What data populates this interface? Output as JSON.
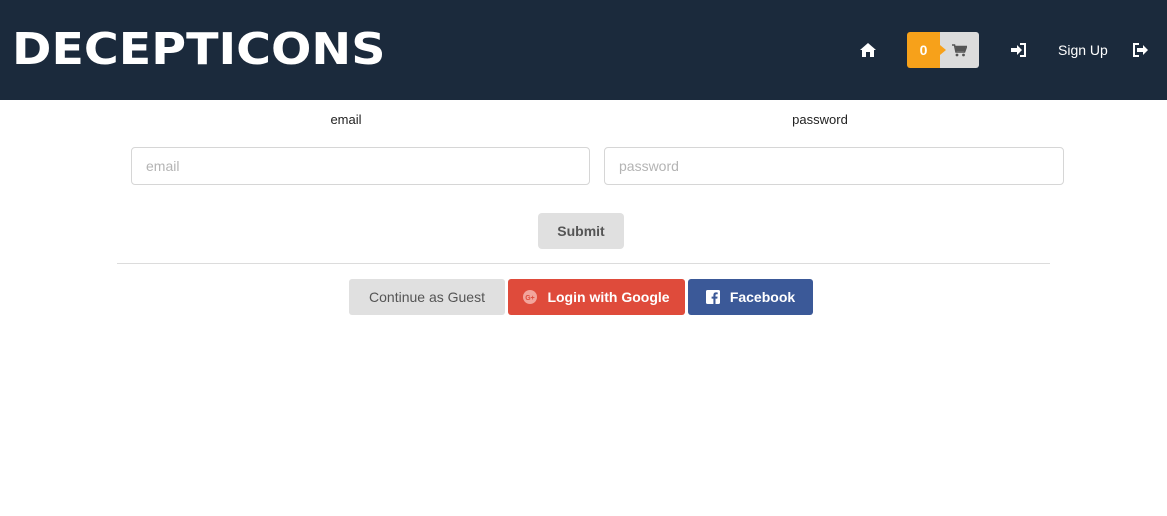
{
  "header": {
    "brand": "DECEPTICONS",
    "cart_count": "0",
    "signup_label": "Sign Up",
    "icons": [
      "home-icon",
      "cart-icon",
      "sign-in-icon",
      "sign-out-icon"
    ]
  },
  "form": {
    "email_label": "email",
    "email_placeholder": "email",
    "password_label": "password",
    "password_placeholder": "password",
    "submit_label": "Submit"
  },
  "social": {
    "guest_label": "Continue as Guest",
    "google_label": "Login with Google",
    "facebook_label": "Facebook"
  },
  "colors": {
    "navbar": "#1b2a3c",
    "cart_badge": "#f7a11a",
    "google": "#df4b3b",
    "facebook": "#3b5998"
  }
}
